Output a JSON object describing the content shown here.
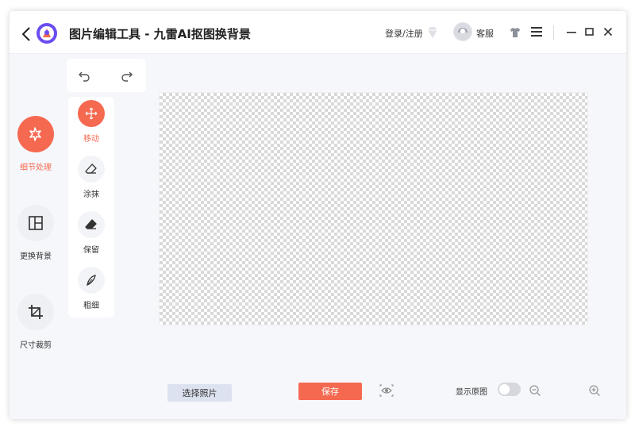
{
  "app": {
    "title": "图片编辑工具 - 九雷AI抠图换背景"
  },
  "header": {
    "login_label": "登录/注册",
    "support_label": "客服",
    "icons": [
      "back-arrow-icon",
      "app-logo-icon",
      "diamond-icon",
      "support-avatar-icon",
      "tshirt-icon",
      "menu-icon",
      "minimize-icon",
      "maximize-icon",
      "close-icon"
    ]
  },
  "sidebar": {
    "items": [
      {
        "label": "细节处理",
        "icon": "detail-magic-icon",
        "active": true
      },
      {
        "label": "更换背景",
        "icon": "layout-icon",
        "active": false
      },
      {
        "label": "尺寸裁剪",
        "icon": "crop-icon",
        "active": false
      }
    ]
  },
  "history": {
    "icons": [
      "undo-icon",
      "redo-icon"
    ]
  },
  "tools": {
    "items": [
      {
        "label": "移动",
        "icon": "move-icon",
        "active": true
      },
      {
        "label": "涂抹",
        "icon": "eraser-icon",
        "active": false
      },
      {
        "label": "保留",
        "icon": "keep-eraser-icon",
        "active": false
      },
      {
        "label": "粗细",
        "icon": "brush-size-icon",
        "active": false
      }
    ]
  },
  "footer": {
    "select_photo_label": "选择照片",
    "save_label": "保存",
    "show_original_label": "显示原图",
    "show_original_on": false
  },
  "colors": {
    "accent": "#f56951",
    "button_secondary": "#dde2f0",
    "background": "#f6f7fb"
  }
}
